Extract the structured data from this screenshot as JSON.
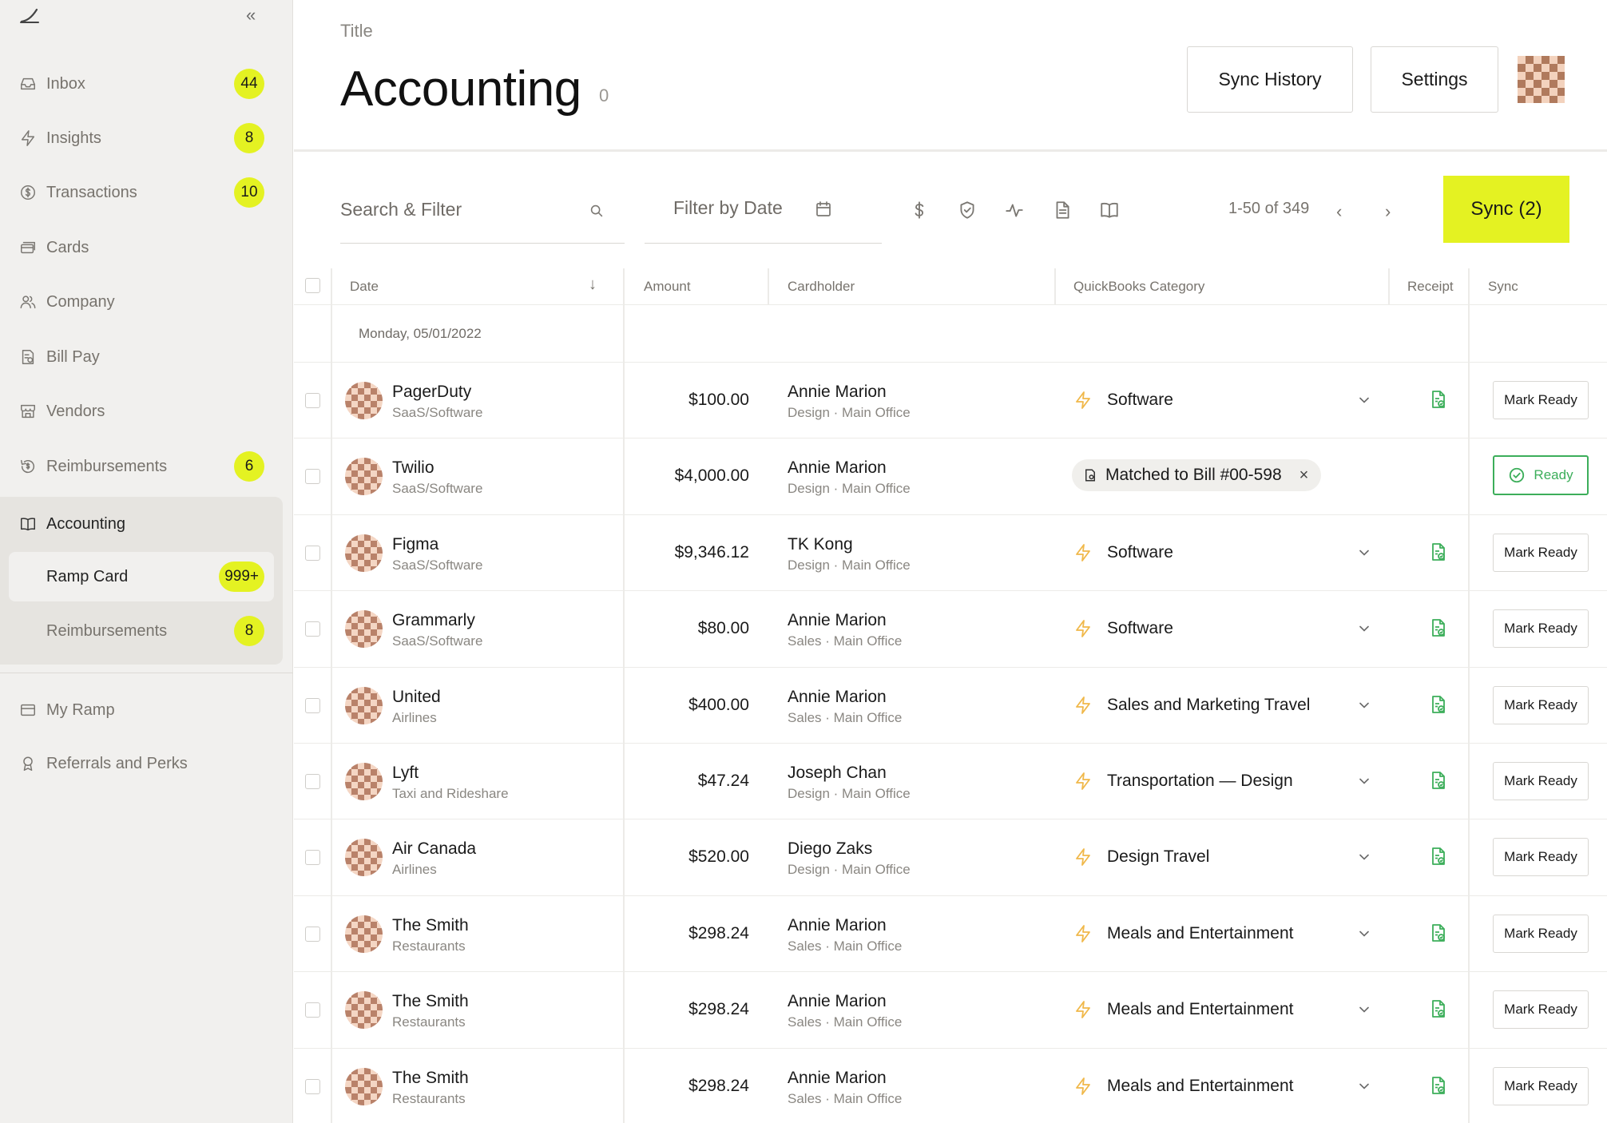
{
  "sidebar": {
    "items": [
      {
        "label": "Inbox",
        "badge": "44",
        "icon": "inbox-icon"
      },
      {
        "label": "Insights",
        "badge": "8",
        "icon": "lightning-icon"
      },
      {
        "label": "Transactions",
        "badge": "10",
        "icon": "dollar-circle-icon"
      },
      {
        "label": "Cards",
        "badge": "",
        "icon": "cards-icon"
      },
      {
        "label": "Company",
        "badge": "",
        "icon": "users-icon"
      },
      {
        "label": "Bill Pay",
        "badge": "",
        "icon": "bill-icon"
      },
      {
        "label": "Vendors",
        "badge": "",
        "icon": "store-icon"
      },
      {
        "label": "Reimbursements",
        "badge": "6",
        "icon": "refund-icon"
      }
    ],
    "accounting": {
      "label": "Accounting",
      "sub": [
        {
          "label": "Ramp Card",
          "badge": "999+"
        },
        {
          "label": "Reimbursements",
          "badge": "8"
        }
      ]
    },
    "bottom": [
      {
        "label": "My Ramp",
        "icon": "card-icon"
      },
      {
        "label": "Referrals and Perks",
        "icon": "award-icon"
      }
    ]
  },
  "header": {
    "kicker": "Title",
    "title": "Accounting",
    "count": "0",
    "sync_history": "Sync History",
    "settings": "Settings"
  },
  "toolbar": {
    "search_placeholder": "Search & Filter",
    "date_placeholder": "Filter by Date",
    "pager": "1-50 of 349",
    "sync_label": "Sync (2)"
  },
  "table": {
    "columns": {
      "date": "Date",
      "amount": "Amount",
      "cardholder": "Cardholder",
      "category": "QuickBooks Category",
      "receipt": "Receipt",
      "sync": "Sync"
    },
    "group_date": "Monday, 05/01/2022",
    "mark_ready": "Mark Ready",
    "ready": "Ready",
    "rows": [
      {
        "merchant": "PagerDuty",
        "mcat": "SaaS/Software",
        "amount": "$100.00",
        "holder": "Annie Marion",
        "dept": "Design · Main Office",
        "category": "Software",
        "status": "mark"
      },
      {
        "merchant": "Twilio",
        "mcat": "SaaS/Software",
        "amount": "$4,000.00",
        "holder": "Annie Marion",
        "dept": "Design · Main Office",
        "category": "Matched to Bill #00-598",
        "status": "ready"
      },
      {
        "merchant": "Figma",
        "mcat": "SaaS/Software",
        "amount": "$9,346.12",
        "holder": "TK Kong",
        "dept": "Design · Main Office",
        "category": "Software",
        "status": "mark"
      },
      {
        "merchant": "Grammarly",
        "mcat": "SaaS/Software",
        "amount": "$80.00",
        "holder": "Annie Marion",
        "dept": "Sales · Main Office",
        "category": "Software",
        "status": "mark"
      },
      {
        "merchant": "United",
        "mcat": "Airlines",
        "amount": "$400.00",
        "holder": "Annie Marion",
        "dept": "Sales · Main Office",
        "category": "Sales and Marketing Travel",
        "status": "mark"
      },
      {
        "merchant": "Lyft",
        "mcat": "Taxi and Rideshare",
        "amount": "$47.24",
        "holder": "Joseph Chan",
        "dept": "Design · Main Office",
        "category": "Transportation — Design",
        "status": "mark"
      },
      {
        "merchant": "Air Canada",
        "mcat": "Airlines",
        "amount": "$520.00",
        "holder": "Diego Zaks",
        "dept": "Design · Main Office",
        "category": "Design Travel",
        "status": "mark"
      },
      {
        "merchant": "The Smith",
        "mcat": "Restaurants",
        "amount": "$298.24",
        "holder": "Annie Marion",
        "dept": "Sales · Main Office",
        "category": "Meals and Entertainment",
        "status": "mark"
      },
      {
        "merchant": "The Smith",
        "mcat": "Restaurants",
        "amount": "$298.24",
        "holder": "Annie Marion",
        "dept": "Sales · Main Office",
        "category": "Meals and Entertainment",
        "status": "mark"
      },
      {
        "merchant": "The Smith",
        "mcat": "Restaurants",
        "amount": "$298.24",
        "holder": "Annie Marion",
        "dept": "Sales · Main Office",
        "category": "Meals and Entertainment",
        "status": "mark"
      }
    ]
  },
  "colors": {
    "accent": "#e4f222",
    "ready_green": "#3cae5a",
    "sidebar_bg": "#f1f0ee"
  }
}
